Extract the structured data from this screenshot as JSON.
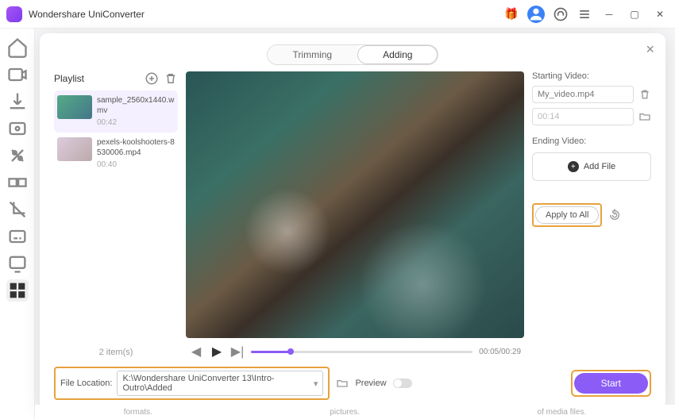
{
  "app": {
    "title": "Wondershare UniConverter"
  },
  "tabs": {
    "trimming": "Trimming",
    "adding": "Adding"
  },
  "playlist": {
    "label": "Playlist",
    "count": "2 item(s)",
    "items": [
      {
        "name": "sample_2560x1440.wmv",
        "duration": "00:42"
      },
      {
        "name": "pexels-koolshooters-8530006.mp4",
        "duration": "00:40"
      }
    ]
  },
  "controls": {
    "time": "00:05/00:29"
  },
  "side": {
    "start_label": "Starting Video:",
    "start_file": "My_video.mp4",
    "start_dur": "00:14",
    "end_label": "Ending Video:",
    "add_file": "Add File",
    "apply_all": "Apply to All"
  },
  "footer": {
    "loc_label": "File Location:",
    "loc_path": "K:\\Wondershare UniConverter 13\\Intro-Outro\\Added",
    "preview": "Preview",
    "start": "Start"
  },
  "strip": {
    "a": "formats.",
    "b": "pictures.",
    "c": "of media files."
  }
}
